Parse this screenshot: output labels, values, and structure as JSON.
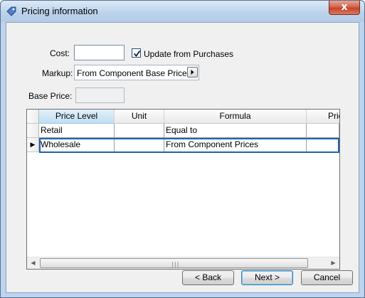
{
  "window": {
    "title": "Pricing information",
    "close_glyph": "x"
  },
  "form": {
    "cost_label": "Cost:",
    "cost_value": "",
    "update_checkbox_label": "Update from Purchases",
    "update_checked": true,
    "markup_label": "Markup:",
    "markup_value": "From Component Base Prices",
    "base_price_label": "Base Price:",
    "base_price_value": ""
  },
  "grid": {
    "columns": [
      "Price Level",
      "Unit",
      "Formula",
      "Pric"
    ],
    "rows": [
      {
        "price_level": "Retail",
        "unit": "",
        "formula": "Equal to",
        "price": ""
      },
      {
        "price_level": "Wholesale",
        "unit": "",
        "formula": "From Component Prices",
        "price": ""
      }
    ],
    "current_row_indicator": "▶",
    "scrollbar_grip": "|||"
  },
  "buttons": {
    "back": "< Back",
    "next": "Next >",
    "cancel": "Cancel"
  },
  "icons": {
    "title": "price-tag-icon",
    "close": "close-icon",
    "checkmark": "checkmark-icon",
    "dropdown": "arrow-right-icon",
    "scroll_left": "scroll-left-arrow-icon",
    "scroll_right": "scroll-right-arrow-icon"
  }
}
